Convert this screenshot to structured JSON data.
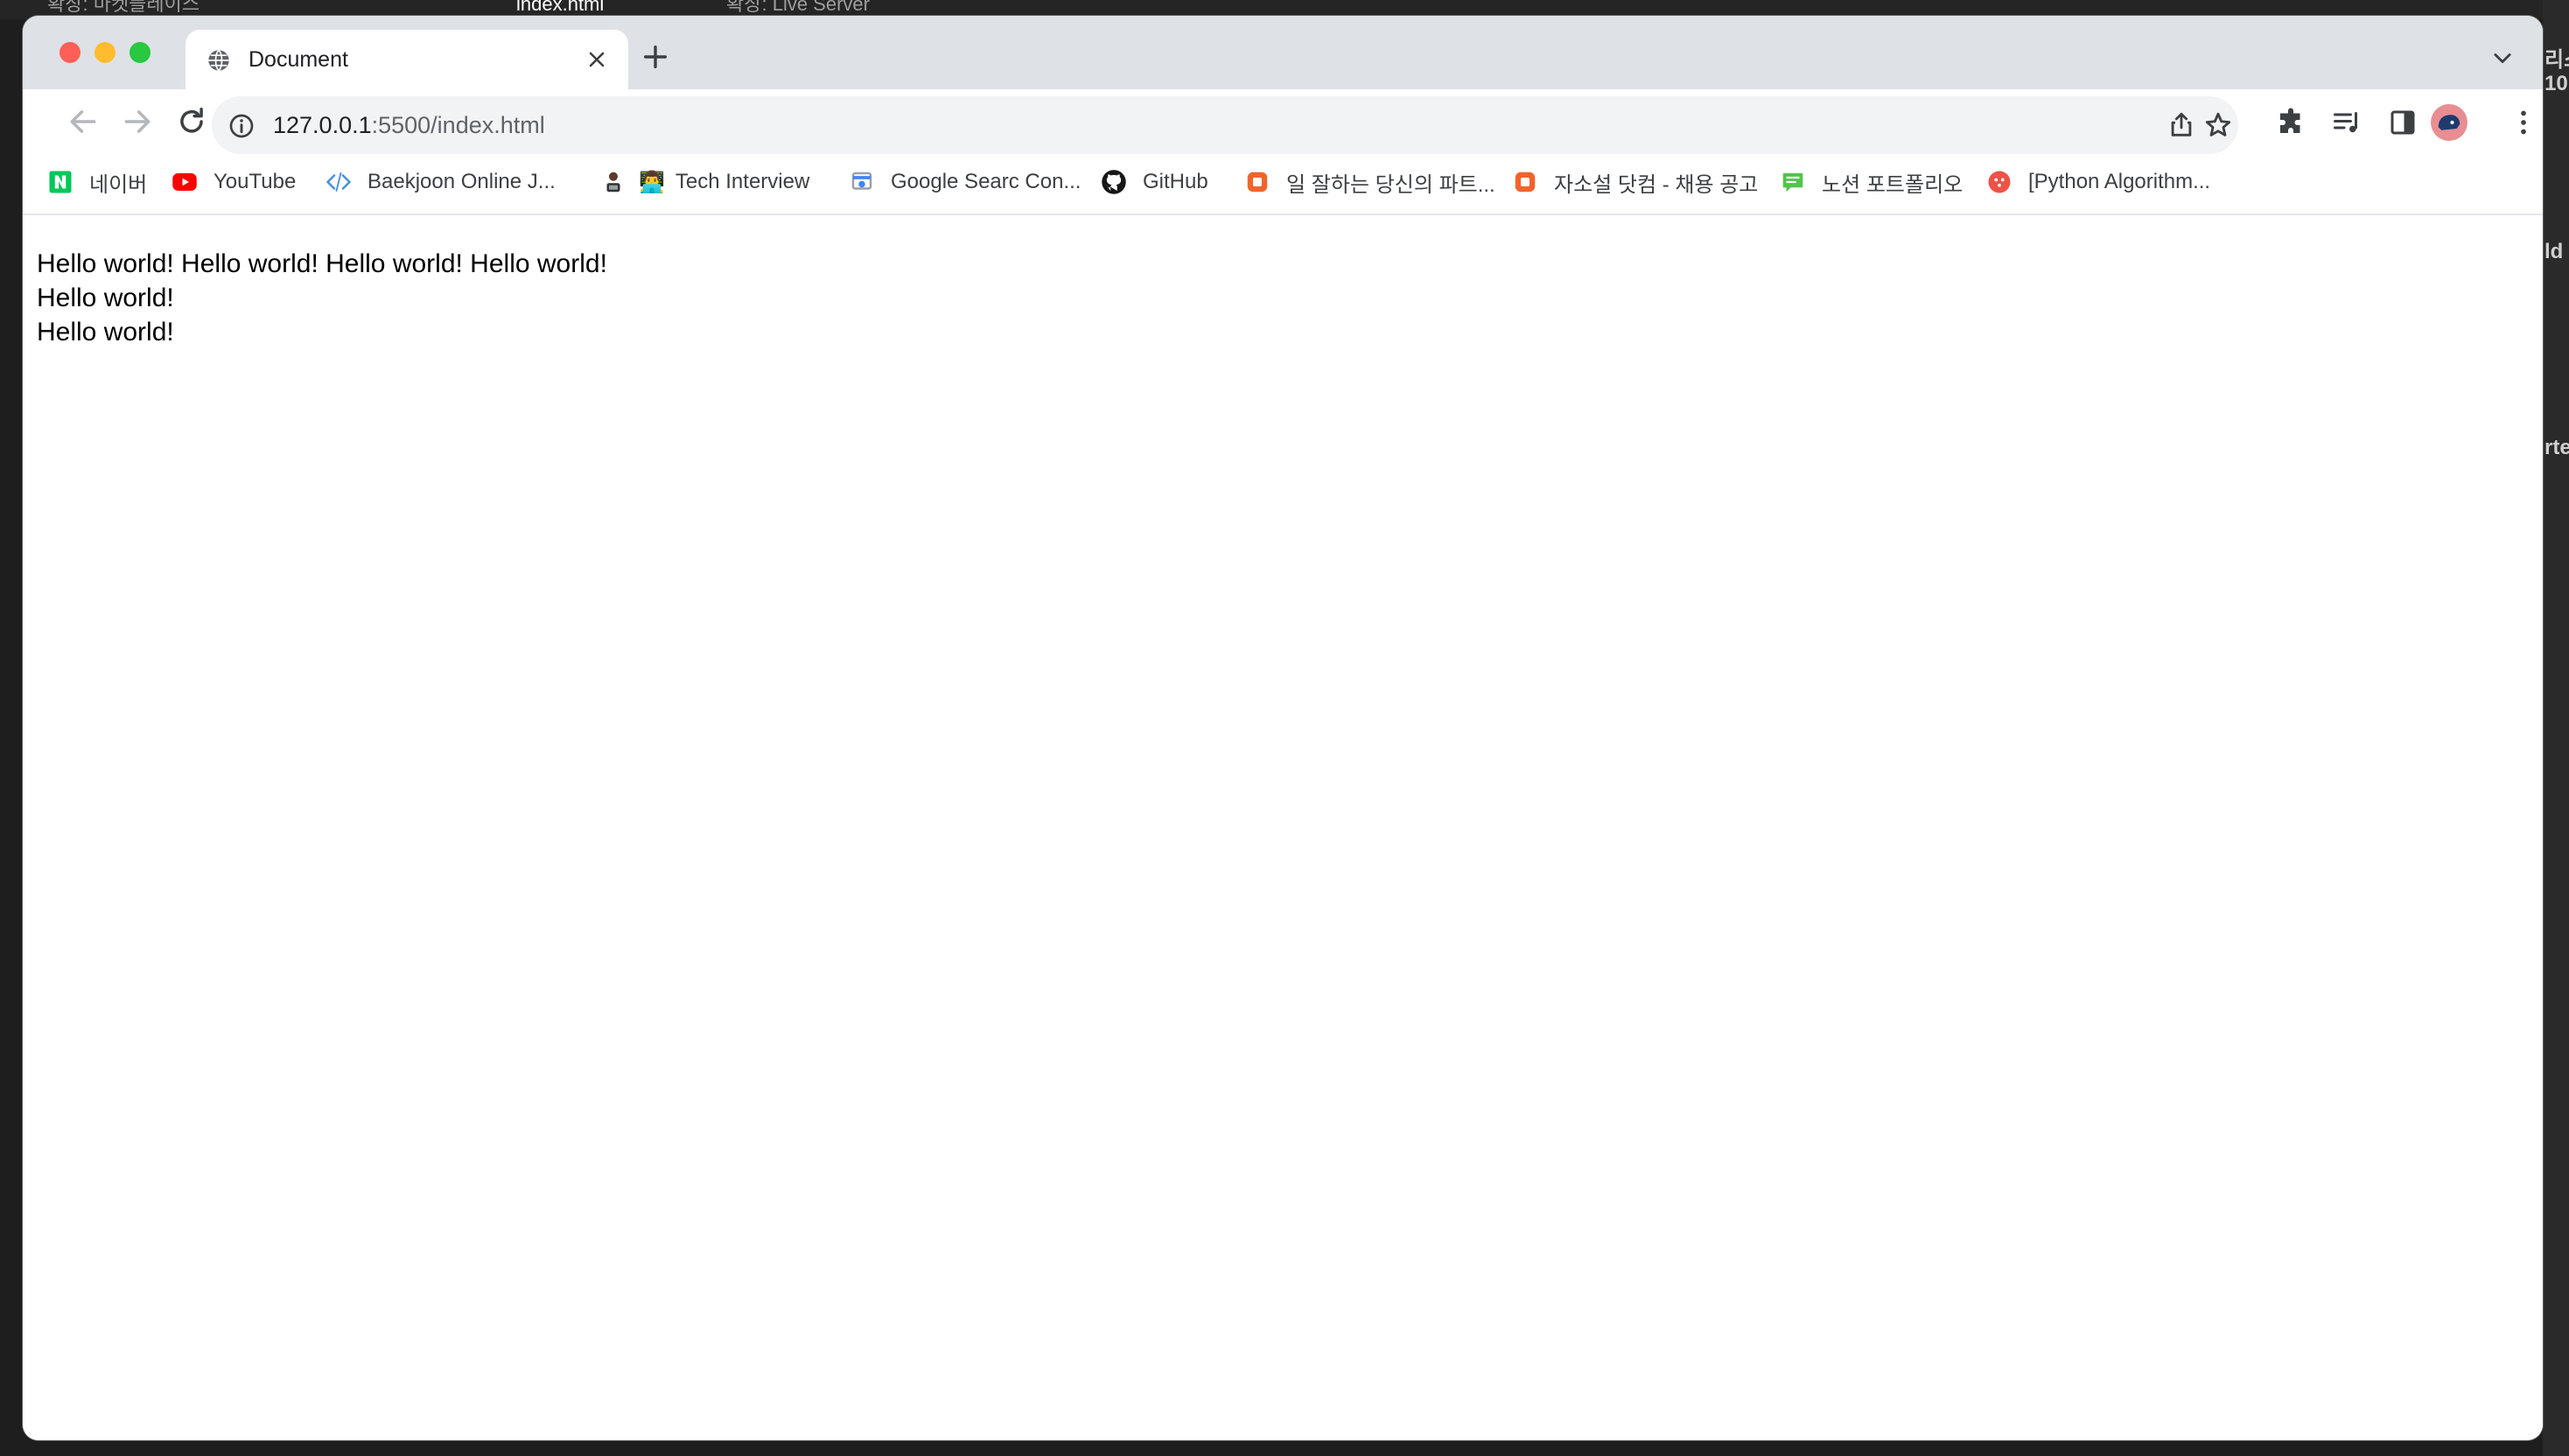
{
  "background": {
    "vscode_tabs": [
      "확장: 마켓플레이스",
      "index.html",
      "확장: Live Server"
    ],
    "right_fragments": [
      "리스",
      "10",
      "ld",
      "rte"
    ]
  },
  "browser": {
    "tab": {
      "title": "Document"
    },
    "address": {
      "host": "127.0.0.1",
      "path": ":5500/index.html"
    },
    "bookmarks": [
      {
        "label": "네이버",
        "icon": "naver-icon",
        "color": "#03c75a"
      },
      {
        "label": "YouTube",
        "icon": "youtube-icon",
        "color": "#ff0000"
      },
      {
        "label": "Baekjoon Online J...",
        "icon": "code-brackets-icon",
        "color": "#4a90d9"
      },
      {
        "label": "Tech Interview",
        "icon": "developer-emoji-icon",
        "color": "#333333"
      },
      {
        "label": "Google Searc Con...",
        "icon": "search-console-icon",
        "color": "#4285f4"
      },
      {
        "label": "GitHub",
        "icon": "github-icon",
        "color": "#181717"
      },
      {
        "label": "일 잘하는 당신의 파트...",
        "icon": "orange-square-icon",
        "color": "#f0642c"
      },
      {
        "label": "자소설 닷컴 - 채용 공고",
        "icon": "orange-square-icon",
        "color": "#f0642c"
      },
      {
        "label": "노션 포트폴리오",
        "icon": "blog-icon",
        "color": "#4fc54a"
      },
      {
        "label": "[Python Algorithm...",
        "icon": "red-circle-icon",
        "color": "#ec5347"
      }
    ]
  },
  "page": {
    "lines": [
      "Hello world! Hello world! Hello world! Hello world!",
      "Hello world!",
      "Hello world!"
    ]
  }
}
